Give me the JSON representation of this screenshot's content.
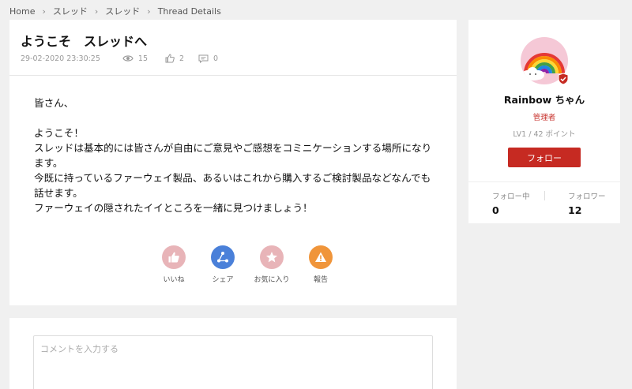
{
  "breadcrumb": [
    "Home",
    "スレッド",
    "スレッド",
    "Thread Details"
  ],
  "post": {
    "title": "ようこそ　スレッドへ",
    "date": "29-02-2020 23:30:25",
    "views": "15",
    "likes": "2",
    "comments": "0",
    "body": {
      "greeting": "皆さん、",
      "welcome": "ようこそ！",
      "para1": "スレッドは基本的には皆さんが自由にご意見やご感想をコミニケーションする場所になります。",
      "para2": "今既に持っているファーウェイ製品、あるいはこれから購入するご検討製品などなんでも話せます。",
      "para3": "ファーウェイの隠されたイイところを一緒に見つけましょう！"
    }
  },
  "actions": [
    {
      "label": "いいね",
      "icon": "thumbs-up-icon",
      "color": "#e8b4b8"
    },
    {
      "label": "シェア",
      "icon": "share-icon",
      "color": "#4a80d9"
    },
    {
      "label": "お気に入り",
      "icon": "star-icon",
      "color": "#e8b4b8"
    },
    {
      "label": "報告",
      "icon": "warning-icon",
      "color": "#f0953a"
    }
  ],
  "comment": {
    "placeholder": "コメントを入力する"
  },
  "profile": {
    "name": "Rainbow ちゃん",
    "role": "管理者",
    "level": "LV1 / 42 ポイント",
    "follow_button": "フォロー",
    "following_label": "フォロー中",
    "following_count": "0",
    "followers_label": "フォロワー",
    "followers_count": "12"
  },
  "colors": {
    "accent": "#c62a22",
    "background": "#f0f0f0"
  }
}
